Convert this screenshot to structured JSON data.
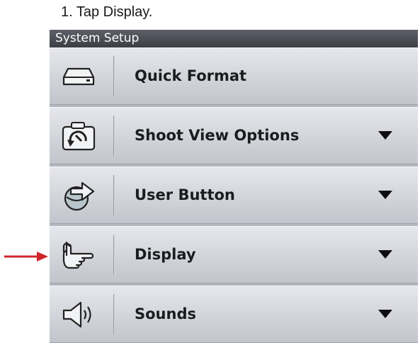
{
  "instruction": "1. Tap Display.",
  "panel": {
    "title": "System Setup",
    "items": [
      {
        "label": "Quick Format",
        "icon": "drive-icon",
        "has_dropdown": false
      },
      {
        "label": "Shoot View Options",
        "icon": "camera-rotate-icon",
        "has_dropdown": true
      },
      {
        "label": "User Button",
        "icon": "user-button-icon",
        "has_dropdown": true
      },
      {
        "label": "Display",
        "icon": "pointing-hand-icon",
        "has_dropdown": true
      },
      {
        "label": "Sounds",
        "icon": "speaker-icon",
        "has_dropdown": true
      }
    ]
  },
  "colors": {
    "arrow": "#d0252b",
    "title_bar": "#4a4d53",
    "row_light": "#e7e8ed",
    "row_dark": "#c1c4cb"
  }
}
